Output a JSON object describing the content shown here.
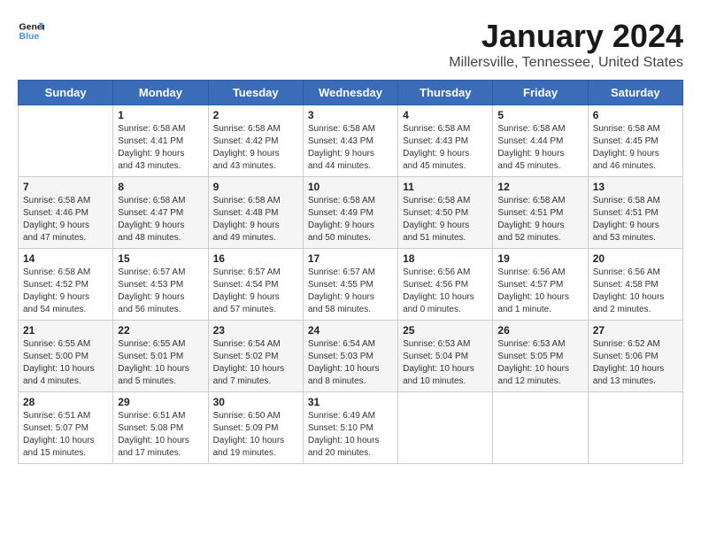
{
  "header": {
    "logo_line1": "General",
    "logo_line2": "Blue",
    "title": "January 2024",
    "subtitle": "Millersville, Tennessee, United States"
  },
  "weekdays": [
    "Sunday",
    "Monday",
    "Tuesday",
    "Wednesday",
    "Thursday",
    "Friday",
    "Saturday"
  ],
  "weeks": [
    [
      {
        "day": "",
        "info": ""
      },
      {
        "day": "1",
        "info": "Sunrise: 6:58 AM\nSunset: 4:41 PM\nDaylight: 9 hours\nand 43 minutes."
      },
      {
        "day": "2",
        "info": "Sunrise: 6:58 AM\nSunset: 4:42 PM\nDaylight: 9 hours\nand 43 minutes."
      },
      {
        "day": "3",
        "info": "Sunrise: 6:58 AM\nSunset: 4:43 PM\nDaylight: 9 hours\nand 44 minutes."
      },
      {
        "day": "4",
        "info": "Sunrise: 6:58 AM\nSunset: 4:43 PM\nDaylight: 9 hours\nand 45 minutes."
      },
      {
        "day": "5",
        "info": "Sunrise: 6:58 AM\nSunset: 4:44 PM\nDaylight: 9 hours\nand 45 minutes."
      },
      {
        "day": "6",
        "info": "Sunrise: 6:58 AM\nSunset: 4:45 PM\nDaylight: 9 hours\nand 46 minutes."
      }
    ],
    [
      {
        "day": "7",
        "info": ""
      },
      {
        "day": "8",
        "info": "Sunrise: 6:58 AM\nSunset: 4:47 PM\nDaylight: 9 hours\nand 48 minutes."
      },
      {
        "day": "9",
        "info": "Sunrise: 6:58 AM\nSunset: 4:48 PM\nDaylight: 9 hours\nand 49 minutes."
      },
      {
        "day": "10",
        "info": "Sunrise: 6:58 AM\nSunset: 4:49 PM\nDaylight: 9 hours\nand 50 minutes."
      },
      {
        "day": "11",
        "info": "Sunrise: 6:58 AM\nSunset: 4:50 PM\nDaylight: 9 hours\nand 51 minutes."
      },
      {
        "day": "12",
        "info": "Sunrise: 6:58 AM\nSunset: 4:51 PM\nDaylight: 9 hours\nand 52 minutes."
      },
      {
        "day": "13",
        "info": "Sunrise: 6:58 AM\nSunset: 4:51 PM\nDaylight: 9 hours\nand 53 minutes."
      }
    ],
    [
      {
        "day": "14",
        "info": "Sunrise: 6:58 AM\nSunset: 4:52 PM\nDaylight: 9 hours\nand 54 minutes."
      },
      {
        "day": "15",
        "info": "Sunrise: 6:57 AM\nSunset: 4:53 PM\nDaylight: 9 hours\nand 56 minutes."
      },
      {
        "day": "16",
        "info": "Sunrise: 6:57 AM\nSunset: 4:54 PM\nDaylight: 9 hours\nand 57 minutes."
      },
      {
        "day": "17",
        "info": "Sunrise: 6:57 AM\nSunset: 4:55 PM\nDaylight: 9 hours\nand 58 minutes."
      },
      {
        "day": "18",
        "info": "Sunrise: 6:56 AM\nSunset: 4:56 PM\nDaylight: 10 hours\nand 0 minutes."
      },
      {
        "day": "19",
        "info": "Sunrise: 6:56 AM\nSunset: 4:57 PM\nDaylight: 10 hours\nand 1 minute."
      },
      {
        "day": "20",
        "info": "Sunrise: 6:56 AM\nSunset: 4:58 PM\nDaylight: 10 hours\nand 2 minutes."
      }
    ],
    [
      {
        "day": "21",
        "info": "Sunrise: 6:55 AM\nSunset: 5:00 PM\nDaylight: 10 hours\nand 4 minutes."
      },
      {
        "day": "22",
        "info": "Sunrise: 6:55 AM\nSunset: 5:01 PM\nDaylight: 10 hours\nand 5 minutes."
      },
      {
        "day": "23",
        "info": "Sunrise: 6:54 AM\nSunset: 5:02 PM\nDaylight: 10 hours\nand 7 minutes."
      },
      {
        "day": "24",
        "info": "Sunrise: 6:54 AM\nSunset: 5:03 PM\nDaylight: 10 hours\nand 8 minutes."
      },
      {
        "day": "25",
        "info": "Sunrise: 6:53 AM\nSunset: 5:04 PM\nDaylight: 10 hours\nand 10 minutes."
      },
      {
        "day": "26",
        "info": "Sunrise: 6:53 AM\nSunset: 5:05 PM\nDaylight: 10 hours\nand 12 minutes."
      },
      {
        "day": "27",
        "info": "Sunrise: 6:52 AM\nSunset: 5:06 PM\nDaylight: 10 hours\nand 13 minutes."
      }
    ],
    [
      {
        "day": "28",
        "info": "Sunrise: 6:51 AM\nSunset: 5:07 PM\nDaylight: 10 hours\nand 15 minutes."
      },
      {
        "day": "29",
        "info": "Sunrise: 6:51 AM\nSunset: 5:08 PM\nDaylight: 10 hours\nand 17 minutes."
      },
      {
        "day": "30",
        "info": "Sunrise: 6:50 AM\nSunset: 5:09 PM\nDaylight: 10 hours\nand 19 minutes."
      },
      {
        "day": "31",
        "info": "Sunrise: 6:49 AM\nSunset: 5:10 PM\nDaylight: 10 hours\nand 20 minutes."
      },
      {
        "day": "",
        "info": ""
      },
      {
        "day": "",
        "info": ""
      },
      {
        "day": "",
        "info": ""
      }
    ]
  ],
  "week7_sunday_info": "Sunrise: 6:58 AM\nSunset: 4:46 PM\nDaylight: 9 hours\nand 47 minutes."
}
